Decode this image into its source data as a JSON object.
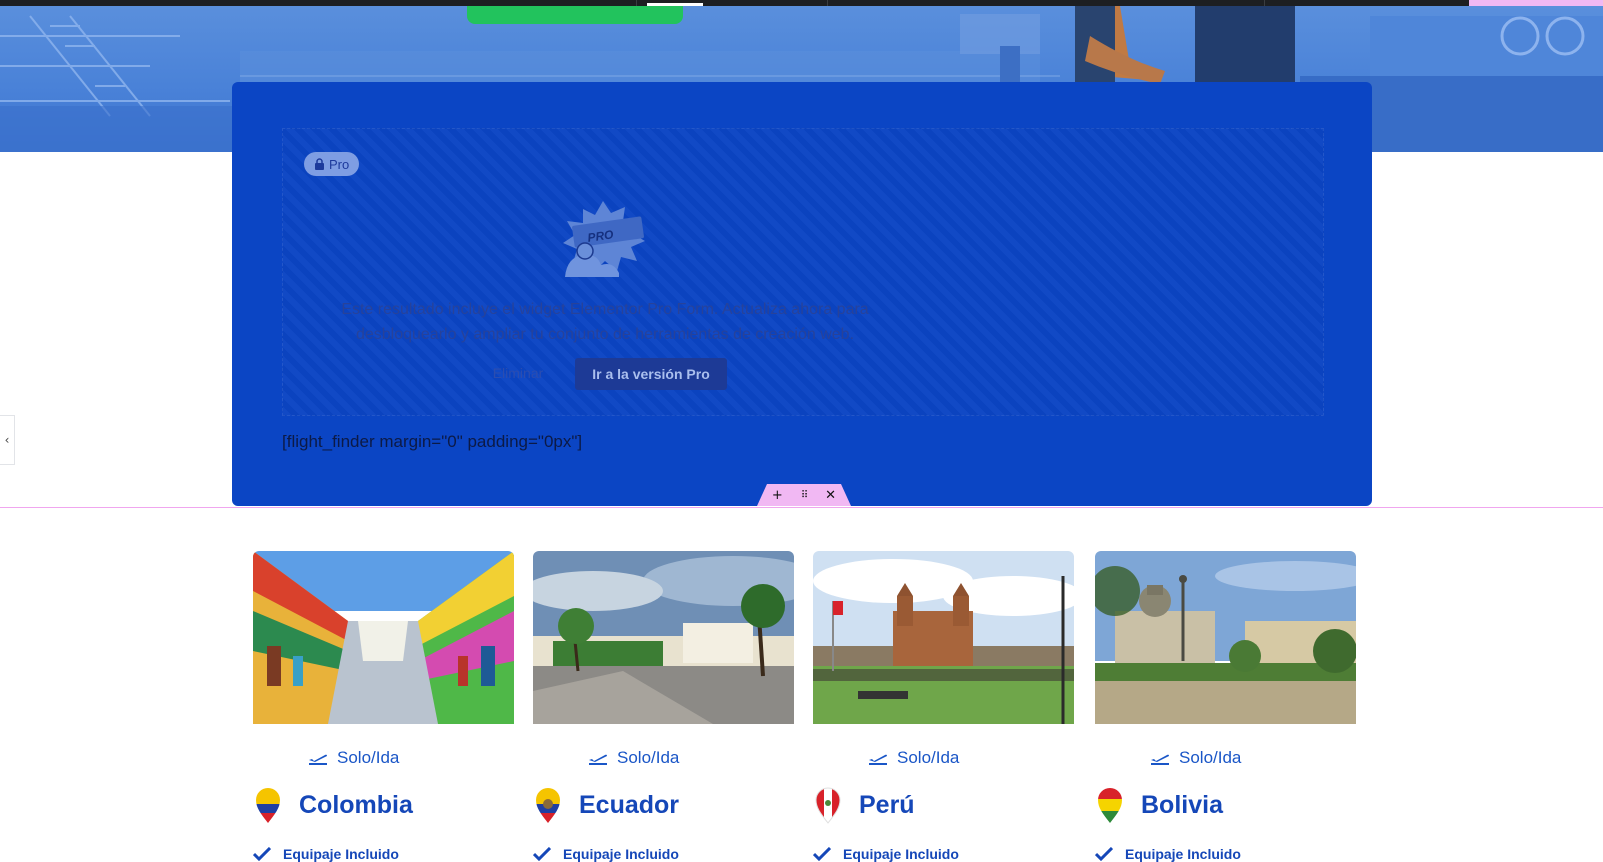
{
  "editor": {
    "pro_badge": "Pro",
    "pro_message": "Este resultado incluye el widget Elementor Pro Form. Actualiza ahora para desbloquearlo y ampliar tu conjunto de herramientas de creación web.",
    "delete_label": "Eliminar",
    "upgrade_label": "Ir a la versión Pro",
    "shortcode": "[flight_finder margin=\"0\" padding=\"0px\"]",
    "handle_icons": [
      "plus-icon",
      "drag-handle-icon",
      "close-icon"
    ]
  },
  "destinations": [
    {
      "trip_type": "Solo/Ida",
      "country": "Colombia",
      "feature": "Equipaje Incluido"
    },
    {
      "trip_type": "Solo/Ida",
      "country": "Ecuador",
      "feature": "Equipaje Incluido"
    },
    {
      "trip_type": "Solo/Ida",
      "country": "Perú",
      "feature": "Equipaje Incluido"
    },
    {
      "trip_type": "Solo/Ida",
      "country": "Bolivia",
      "feature": "Equipaje Incluido"
    }
  ],
  "colors": {
    "section_blue": "#0b45c4",
    "accent_blue": "#1547b8",
    "editor_pink": "#f1b8f3",
    "cta_green": "#22c35d"
  }
}
